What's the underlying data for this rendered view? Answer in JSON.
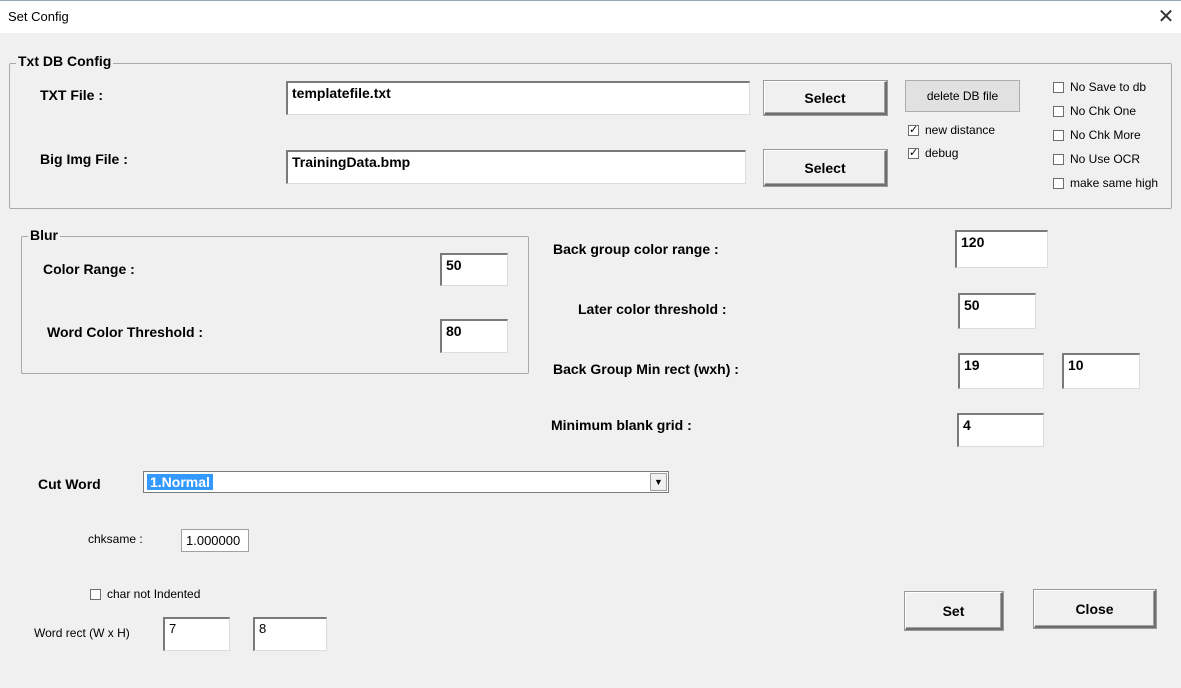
{
  "window": {
    "title": "Set Config",
    "close_glyph": "✕"
  },
  "txt_db": {
    "group_label": "Txt DB Config",
    "txt_file_label": "TXT File :",
    "txt_file_value": "templatefile.txt",
    "select_label": "Select",
    "big_img_label": "Big Img File :",
    "big_img_value": "TrainingData.bmp",
    "select2_label": "Select",
    "delete_db_label": "delete DB file",
    "new_distance_label": "new distance",
    "new_distance_checked": true,
    "debug_label": "debug",
    "debug_checked": true,
    "options": [
      {
        "label": "No Save to db",
        "checked": false
      },
      {
        "label": "No Chk One",
        "checked": false
      },
      {
        "label": "No Chk More",
        "checked": false
      },
      {
        "label": "No Use OCR",
        "checked": false
      },
      {
        "label": "make same high",
        "checked": false
      }
    ]
  },
  "blur": {
    "group_label": "Blur",
    "color_range_label": "Color Range :",
    "color_range_value": "50",
    "word_color_label": "Word Color Threshold :",
    "word_color_value": "80"
  },
  "right": {
    "back_group_range_label": "Back group color range :",
    "back_group_range_value": "120",
    "later_threshold_label": "Later color threshold :",
    "later_threshold_value": "50",
    "back_group_min_label": "Back Group Min rect (wxh) :",
    "back_group_min_w": "19",
    "back_group_min_h": "10",
    "min_blank_label": "Minimum blank grid :",
    "min_blank_value": "4"
  },
  "cut_word": {
    "label": "Cut Word",
    "selected": "1.Normal",
    "arrow_glyph": "▼"
  },
  "chksame": {
    "label": "chksame :",
    "value": "1.000000"
  },
  "char_not_indented": {
    "label": "char not Indented",
    "checked": false
  },
  "word_rect": {
    "label": "Word  rect (W x H)",
    "w": "7",
    "h": "8"
  },
  "buttons": {
    "set_label": "Set",
    "close_label": "Close"
  }
}
